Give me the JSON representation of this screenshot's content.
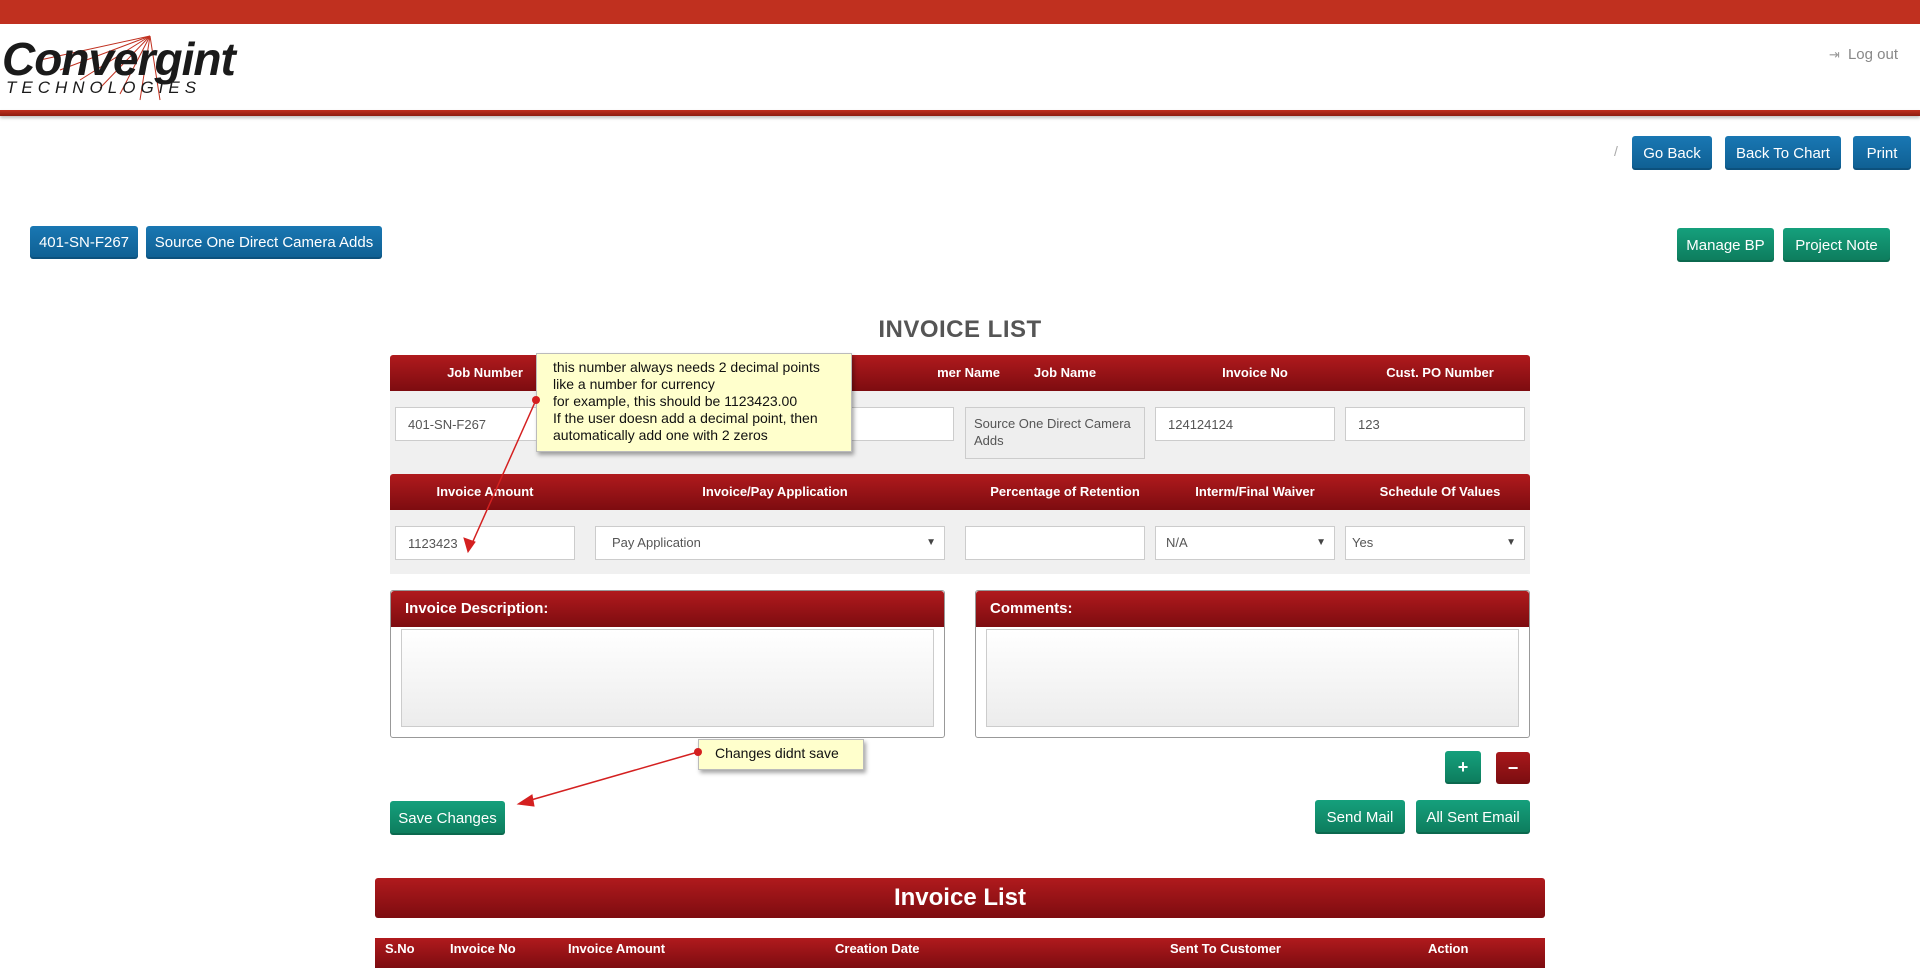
{
  "header": {
    "logo_main": "Convergint",
    "logo_sub": "TECHNOLOGIES",
    "logout_label": "Log out",
    "logout_icon": "sign-out-icon"
  },
  "toolbar": {
    "separator": "/",
    "go_back": "Go Back",
    "back_to_chart": "Back To Chart",
    "print": "Print"
  },
  "project": {
    "job_number_button": "401-SN-F267",
    "job_name_button": "Source One Direct Camera Adds",
    "manage_bp": "Manage BP",
    "project_note": "Project Note"
  },
  "form": {
    "title": "INVOICE LIST",
    "row1_headers": [
      "Job Number",
      "Customer Name",
      "Job Name",
      "Invoice No",
      "Cust. PO Number"
    ],
    "row1_headers_visible": [
      "Job Number",
      "mer Name",
      "Job Name",
      "Invoice No",
      "Cust. PO Number"
    ],
    "job_number": "401-SN-F267",
    "customer_name": "",
    "job_name": "Source One Direct Camera Adds",
    "invoice_no": "124124124",
    "cust_po_number": "123",
    "row2_headers": [
      "Invoice Amount",
      "Invoice/Pay Application",
      "Percentage of Retention",
      "Interm/Final Waiver",
      "Schedule Of Values"
    ],
    "invoice_amount": "1123423",
    "pay_application": "Pay Application",
    "retention": "",
    "waiver": "N/A",
    "schedule_of_values": "Yes",
    "description_label": "Invoice Description:",
    "comments_label": "Comments:",
    "add_icon": "plus-icon",
    "remove_icon": "minus-icon",
    "save_changes": "Save Changes",
    "send_mail": "Send Mail",
    "all_sent_email": "All Sent Email"
  },
  "annotations": {
    "note1_lines": [
      "this number always needs 2 decimal points",
      "like a number for currency",
      "for example, this should be 1123423.00",
      "If the user doesn add a decimal point, then",
      "automatically add one with 2 zeros"
    ],
    "note2": "Changes didnt save"
  },
  "invoice_list": {
    "title": "Invoice List",
    "columns": [
      "S.No",
      "Invoice No",
      "Invoice Amount",
      "Creation Date",
      "Sent To Customer",
      "Action"
    ]
  },
  "colors": {
    "brand_red": "#c0301f",
    "header_red": "#9c1418",
    "button_blue": "#1472ad",
    "button_green": "#11906c",
    "note_yellow": "#ffffcc"
  }
}
